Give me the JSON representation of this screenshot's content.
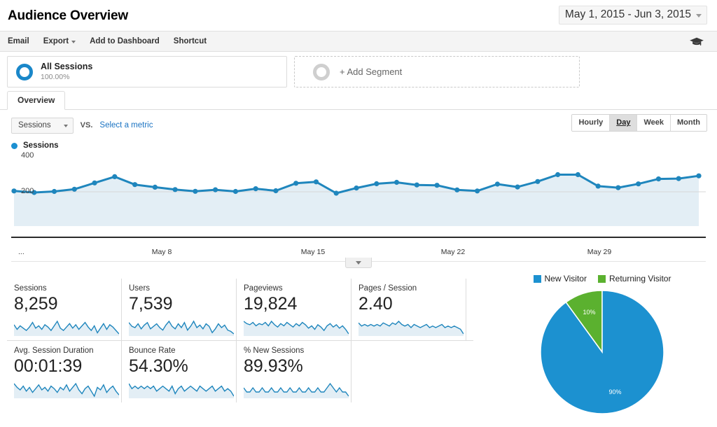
{
  "header": {
    "title": "Audience Overview",
    "date_range": "May 1, 2015 - Jun 3, 2015",
    "date_caret_icon": "chevron-down-icon"
  },
  "toolbar": {
    "items": [
      {
        "label": "Email",
        "has_caret": false
      },
      {
        "label": "Export",
        "has_caret": true
      },
      {
        "label": "Add to Dashboard",
        "has_caret": false
      },
      {
        "label": "Shortcut",
        "has_caret": false
      }
    ],
    "help_icon": "graduation-cap-icon"
  },
  "segments": {
    "active": {
      "name": "All Sessions",
      "percent": "100.00%",
      "icon": "segment-ring-icon"
    },
    "add": {
      "label": "+ Add Segment",
      "icon": "segment-ring-empty-icon"
    }
  },
  "tabs": [
    {
      "label": "Overview",
      "active": true
    }
  ],
  "controls": {
    "metric_selected": "Sessions",
    "metric_caret_icon": "chevron-down-icon",
    "vs_label": "VS.",
    "select_metric_link": "Select a metric",
    "granularity": [
      {
        "label": "Hourly",
        "active": false
      },
      {
        "label": "Day",
        "active": true
      },
      {
        "label": "Week",
        "active": false
      },
      {
        "label": "Month",
        "active": false
      }
    ]
  },
  "chart_legend": {
    "label": "Sessions",
    "color": "#1c8fd1"
  },
  "colors": {
    "line": "#1f86bd",
    "area": "#e3eef5",
    "accent_blue": "#1a87c9",
    "link": "#1a73c2",
    "pie_new": "#1c91d0",
    "pie_returning": "#5bb12f"
  },
  "chart_data": {
    "type": "line",
    "title": "Sessions",
    "xlabel": "",
    "ylabel": "Sessions",
    "ylim": [
      0,
      400
    ],
    "yticks": [
      200,
      400
    ],
    "ytick_labels": [
      "200",
      "400"
    ],
    "grid": false,
    "legend_position": "top-left",
    "x_tick_labels": [
      "...",
      "May 8",
      "May 15",
      "May 22",
      "May 29"
    ],
    "x_tick_positions": [
      0,
      4,
      11,
      18,
      25
    ],
    "series": [
      {
        "name": "Sessions",
        "values": [
          205,
          196,
          202,
          215,
          252,
          288,
          242,
          227,
          213,
          203,
          212,
          202,
          218,
          206,
          250,
          258,
          192,
          222,
          247,
          255,
          240,
          238,
          211,
          205,
          245,
          228,
          260,
          300,
          300,
          233,
          224,
          246,
          275,
          277,
          293
        ]
      }
    ]
  },
  "metrics": [
    {
      "label": "Sessions",
      "value": "8,259",
      "spark": [
        14,
        10,
        13,
        11,
        9,
        12,
        16,
        11,
        13,
        10,
        14,
        12,
        9,
        13,
        17,
        11,
        9,
        12,
        15,
        11,
        14,
        10,
        13,
        16,
        12,
        9,
        13,
        7,
        11,
        15,
        10,
        14,
        12,
        9,
        6
      ]
    },
    {
      "label": "Users",
      "value": "7,539",
      "spark": [
        15,
        12,
        11,
        14,
        10,
        13,
        15,
        10,
        12,
        14,
        11,
        9,
        13,
        16,
        12,
        10,
        14,
        11,
        15,
        9,
        12,
        16,
        11,
        13,
        10,
        14,
        12,
        7,
        10,
        14,
        11,
        13,
        9,
        8,
        6
      ]
    },
    {
      "label": "Pageviews",
      "value": "19,824",
      "spark": [
        16,
        14,
        13,
        15,
        12,
        14,
        13,
        15,
        12,
        16,
        13,
        11,
        14,
        12,
        15,
        13,
        11,
        14,
        12,
        15,
        13,
        10,
        12,
        9,
        13,
        11,
        8,
        12,
        14,
        11,
        13,
        10,
        12,
        9,
        5
      ]
    },
    {
      "label": "Pages / Session",
      "value": "2.40",
      "spark": [
        12,
        10,
        11,
        10,
        11,
        10,
        11,
        10,
        12,
        11,
        10,
        12,
        11,
        13,
        11,
        10,
        11,
        9,
        11,
        10,
        9,
        10,
        11,
        9,
        10,
        9,
        10,
        11,
        9,
        10,
        9,
        10,
        9,
        8,
        5
      ]
    }
  ],
  "metrics_row2": [
    {
      "label": "Avg. Session Duration",
      "value": "00:01:39",
      "spark": [
        16,
        13,
        11,
        14,
        10,
        13,
        9,
        12,
        15,
        11,
        13,
        10,
        14,
        12,
        9,
        13,
        11,
        15,
        10,
        13,
        16,
        11,
        8,
        12,
        14,
        10,
        6,
        13,
        11,
        15,
        9,
        12,
        14,
        10,
        7
      ]
    },
    {
      "label": "Bounce Rate",
      "value": "54.30%",
      "spark": [
        14,
        12,
        13,
        12,
        13,
        12,
        13,
        12,
        13,
        11,
        12,
        13,
        12,
        11,
        13,
        10,
        12,
        13,
        11,
        12,
        13,
        12,
        11,
        13,
        12,
        11,
        12,
        13,
        11,
        12,
        13,
        11,
        12,
        11,
        9
      ]
    },
    {
      "label": "% New Sessions",
      "value": "89.93%",
      "spark": [
        9,
        8,
        8,
        9,
        8,
        8,
        9,
        8,
        8,
        9,
        8,
        8,
        9,
        8,
        8,
        9,
        8,
        8,
        9,
        8,
        8,
        9,
        8,
        8,
        9,
        8,
        8,
        9,
        10,
        9,
        8,
        9,
        8,
        8,
        7
      ]
    }
  ],
  "pie": {
    "legend": [
      {
        "label": "New Visitor",
        "color": "#1c91d0"
      },
      {
        "label": "Returning Visitor",
        "color": "#5bb12f"
      }
    ],
    "slices": [
      {
        "label": "New Visitor",
        "percent_label": "90%",
        "value": 90,
        "color": "#1c91d0"
      },
      {
        "label": "Returning Visitor",
        "percent_label": "10%",
        "value": 10,
        "color": "#5bb12f"
      }
    ]
  }
}
